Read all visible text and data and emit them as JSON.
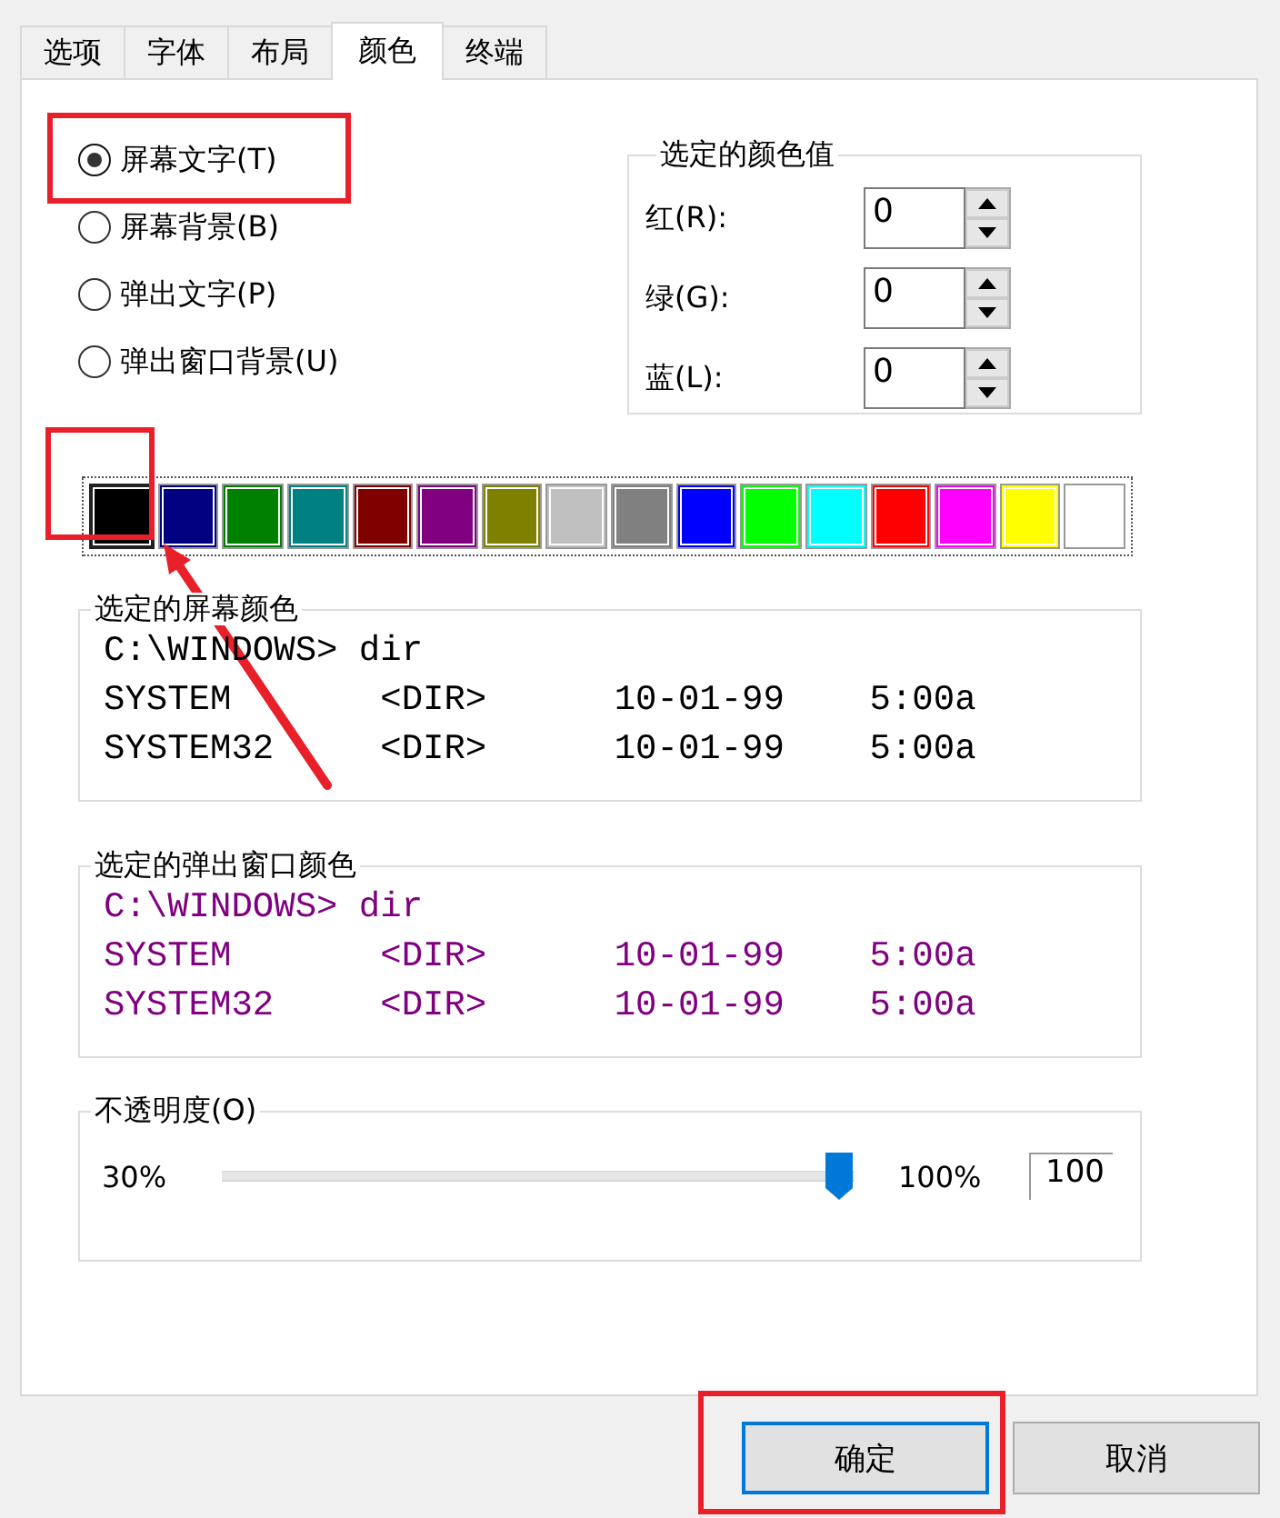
{
  "tabs": [
    {
      "label": "选项",
      "selected": false
    },
    {
      "label": "字体",
      "selected": false
    },
    {
      "label": "布局",
      "selected": false
    },
    {
      "label": "颜色",
      "selected": true
    },
    {
      "label": "终端",
      "selected": false
    }
  ],
  "radios": [
    {
      "label": "屏幕文字(T)",
      "selected": true
    },
    {
      "label": "屏幕背景(B)",
      "selected": false
    },
    {
      "label": "弹出文字(P)",
      "selected": false
    },
    {
      "label": "弹出窗口背景(U)",
      "selected": false
    }
  ],
  "color_values": {
    "title": "选定的颜色值",
    "fields": [
      {
        "label": "红(R):",
        "value": "0"
      },
      {
        "label": "绿(G):",
        "value": "0"
      },
      {
        "label": "蓝(L):",
        "value": "0"
      }
    ]
  },
  "palette": [
    {
      "color": "#000000",
      "selected": true
    },
    {
      "color": "#000080",
      "selected": false
    },
    {
      "color": "#008000",
      "selected": false
    },
    {
      "color": "#008080",
      "selected": false
    },
    {
      "color": "#800000",
      "selected": false
    },
    {
      "color": "#800080",
      "selected": false
    },
    {
      "color": "#808000",
      "selected": false
    },
    {
      "color": "#c0c0c0",
      "selected": false
    },
    {
      "color": "#808080",
      "selected": false
    },
    {
      "color": "#0000ff",
      "selected": false
    },
    {
      "color": "#00ff00",
      "selected": false
    },
    {
      "color": "#00ffff",
      "selected": false
    },
    {
      "color": "#ff0000",
      "selected": false
    },
    {
      "color": "#ff00ff",
      "selected": false
    },
    {
      "color": "#ffff00",
      "selected": false
    },
    {
      "color": "#ffffff",
      "selected": false
    }
  ],
  "previews": [
    {
      "title": "选定的屏幕颜色",
      "color": "#000000",
      "lines": [
        "C:\\WINDOWS> dir",
        "SYSTEM       <DIR>      10-01-99    5:00a",
        "SYSTEM32     <DIR>      10-01-99    5:00a"
      ]
    },
    {
      "title": "选定的弹出窗口颜色",
      "color": "#800080",
      "lines": [
        "C:\\WINDOWS> dir",
        "SYSTEM       <DIR>      10-01-99    5:00a",
        "SYSTEM32     <DIR>      10-01-99    5:00a"
      ]
    }
  ],
  "opacity": {
    "title": "不透明度(O)",
    "min_label": "30%",
    "max_label": "100%",
    "level": 1,
    "value": "100"
  },
  "buttons": [
    {
      "label": "确定",
      "default": true
    },
    {
      "label": "取消",
      "default": false
    }
  ]
}
